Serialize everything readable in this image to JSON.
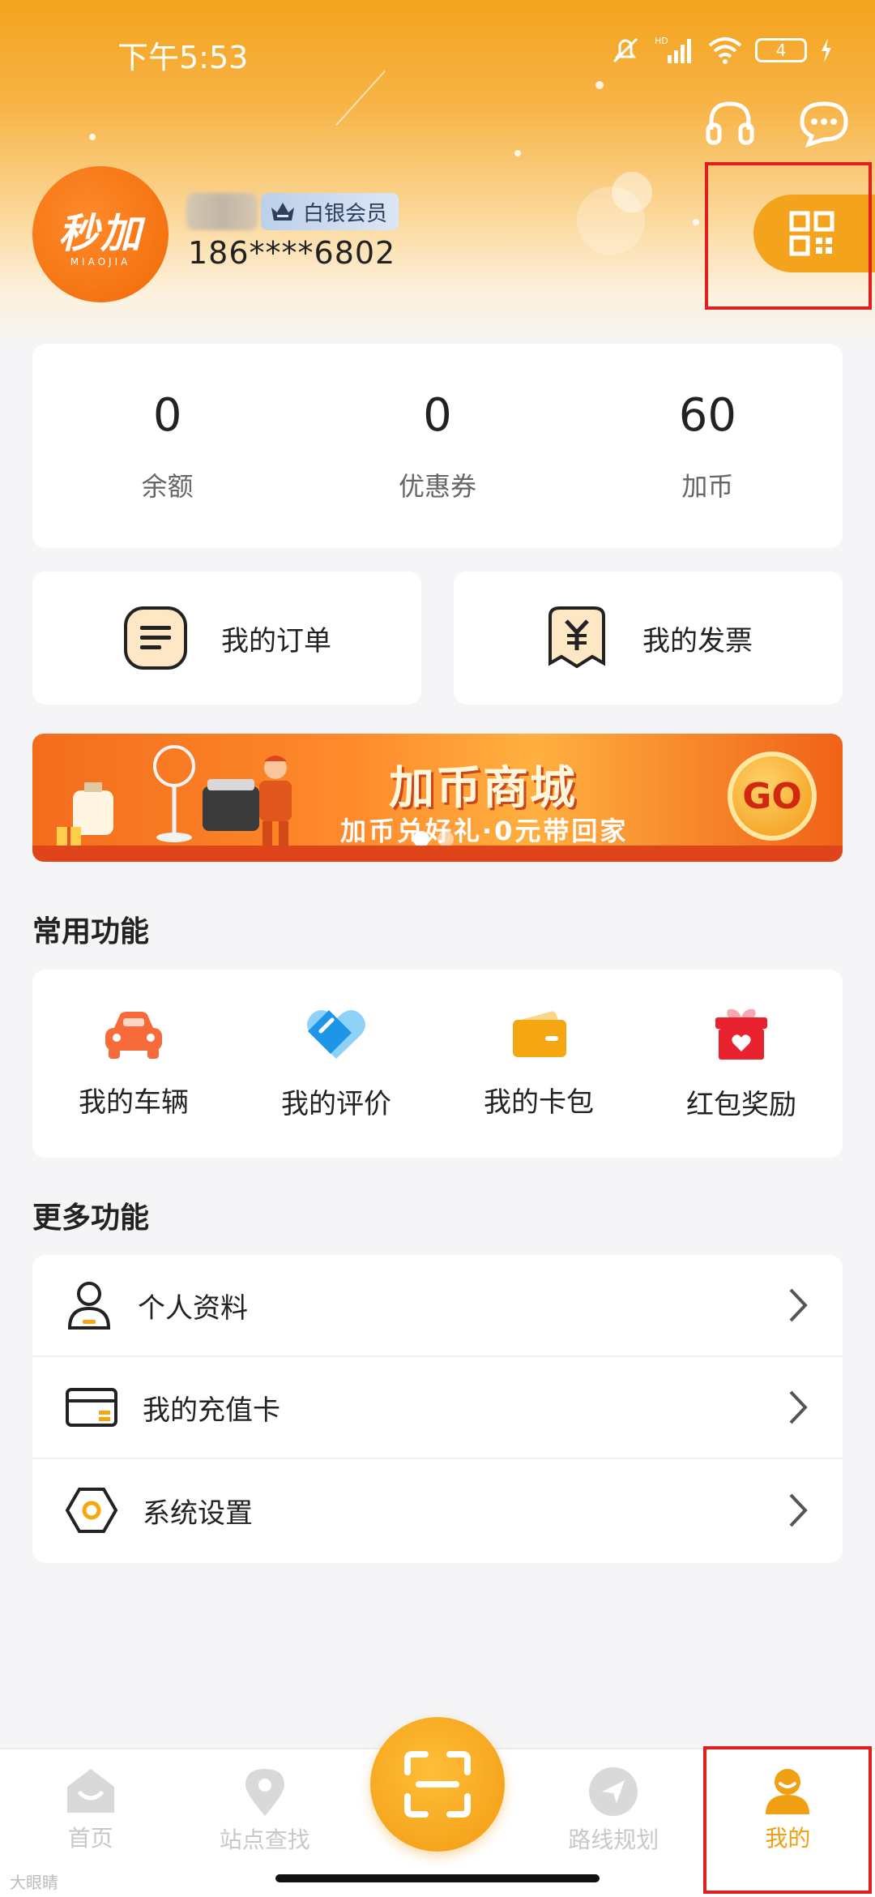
{
  "status_bar": {
    "time": "下午5:53",
    "battery": "4",
    "network": "HD"
  },
  "profile": {
    "avatar_text": "秒加",
    "avatar_subtext": "MIAOJIA",
    "member_level": "白银会员",
    "phone": "186****6802"
  },
  "stats": [
    {
      "value": "0",
      "label": "余额"
    },
    {
      "value": "0",
      "label": "优惠券"
    },
    {
      "value": "60",
      "label": "加币"
    }
  ],
  "quick_links": {
    "orders": "我的订单",
    "invoices": "我的发票"
  },
  "banner": {
    "title": "加币商城",
    "subtitle": "加币兑好礼·0元带回家",
    "go": "GO"
  },
  "common": {
    "title": "常用功能",
    "items": [
      {
        "label": "我的车辆",
        "icon": "car-icon"
      },
      {
        "label": "我的评价",
        "icon": "heart-tag-icon"
      },
      {
        "label": "我的卡包",
        "icon": "wallet-icon"
      },
      {
        "label": "红包奖励",
        "icon": "gift-icon"
      }
    ]
  },
  "more": {
    "title": "更多功能",
    "items": [
      {
        "label": "个人资料",
        "icon": "person-icon"
      },
      {
        "label": "我的充值卡",
        "icon": "card-icon"
      },
      {
        "label": "系统设置",
        "icon": "settings-hex-icon"
      }
    ]
  },
  "nav": {
    "home": "首页",
    "stations": "站点查找",
    "route": "路线规划",
    "mine": "我的"
  },
  "watermark": "大眼睛"
}
